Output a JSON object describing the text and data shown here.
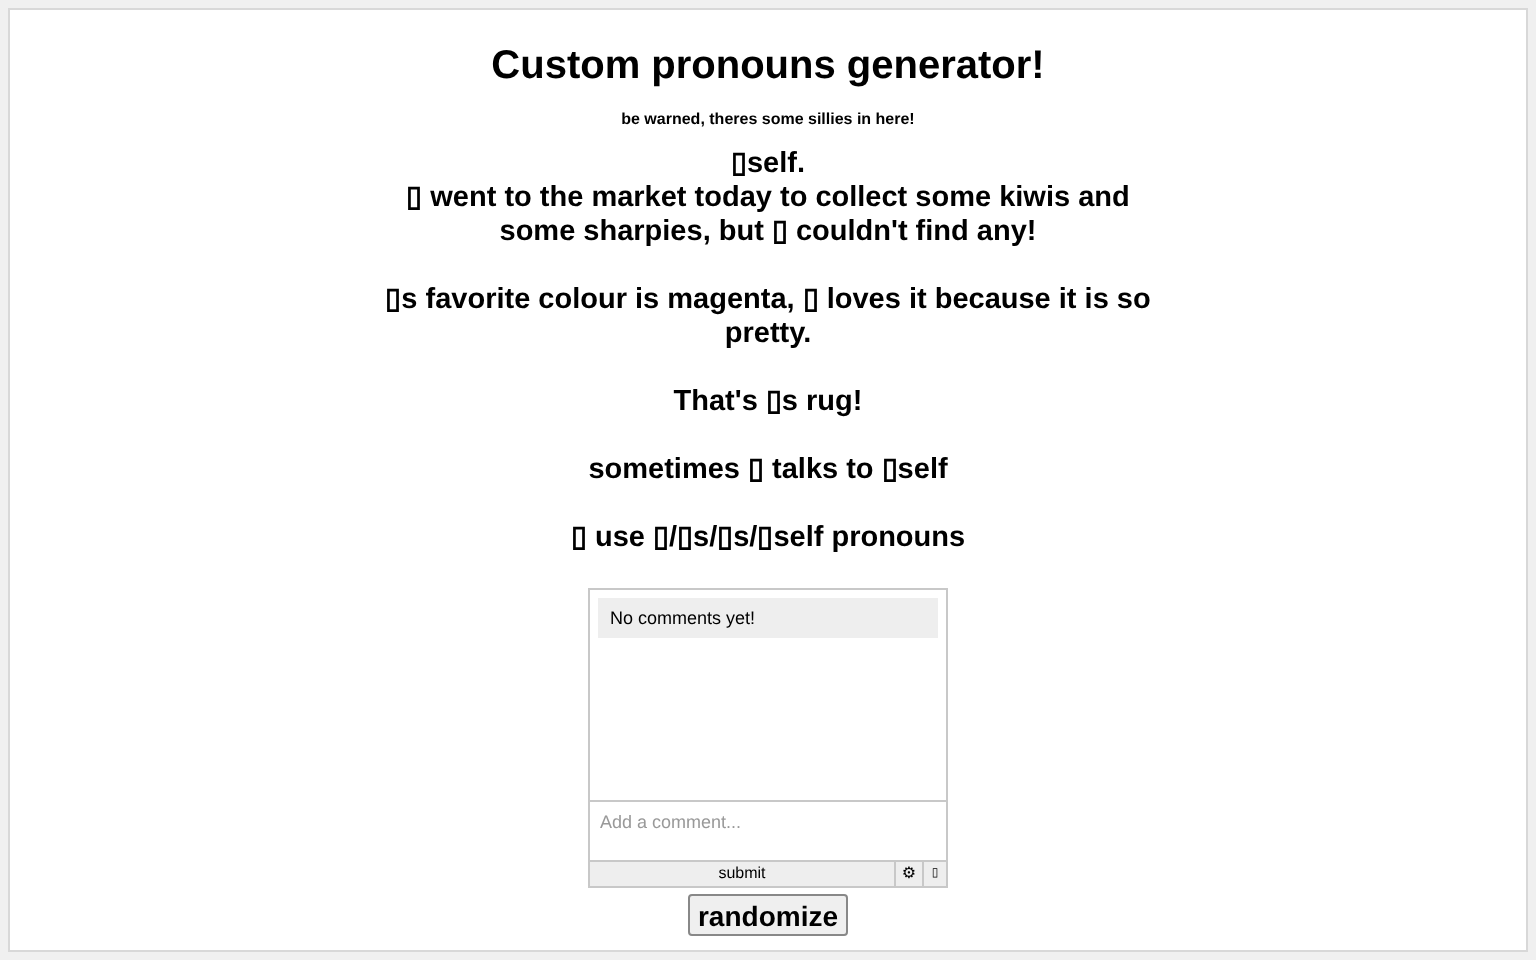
{
  "title": "Custom pronouns generator!",
  "subtitle": "be warned, theres some sillies in here!",
  "paragraphs": [
    "▯self.\n▯ went to the market today to collect some kiwis and some sharpies, but ▯ couldn't find any!",
    "▯s favorite colour is magenta, ▯ loves it because it is so pretty.",
    "That's ▯s rug!",
    "sometimes ▯ talks to ▯self",
    "▯ use ▯/▯s/▯s/▯self pronouns"
  ],
  "comments": {
    "empty_message": "No comments yet!",
    "placeholder": "Add a comment...",
    "submit": "submit",
    "settings_glyph": "⚙",
    "extra_glyph": "▯"
  },
  "randomize_button": "randomize"
}
